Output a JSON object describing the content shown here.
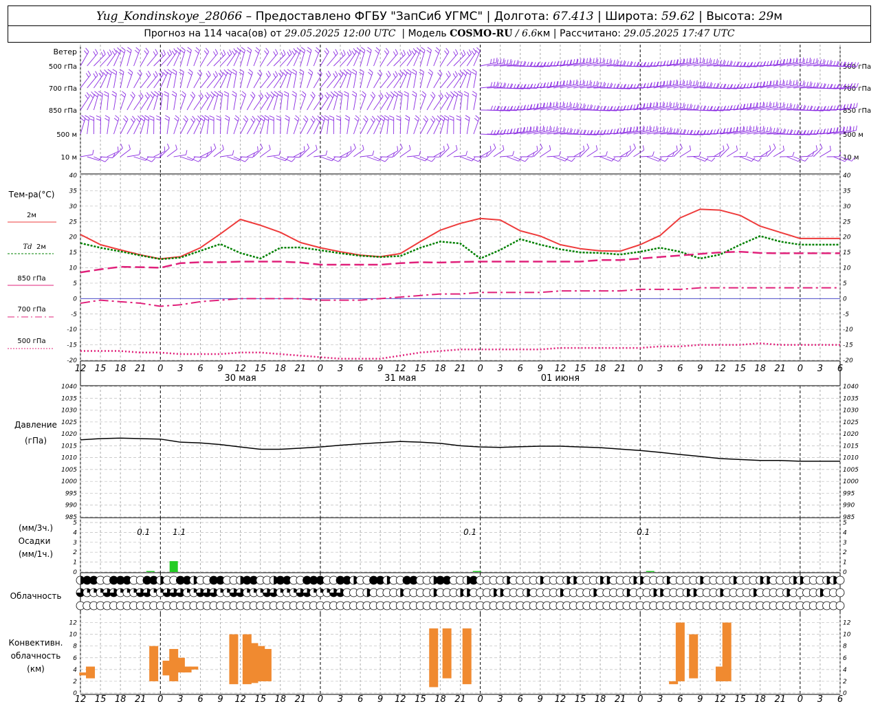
{
  "header": {
    "station": "Yug_Kondinskoye_28066",
    "dash": " – ",
    "provider": "Предоставлено ФГБУ \"ЗапСиб УГМС\"",
    "lon_label": "Долгота:",
    "lon": "67.413",
    "lat_label": "Широта:",
    "lat": "59.62",
    "alt_label": "Высота:",
    "alt": "29",
    "alt_unit": "м",
    "forecast_label": "Прогноз на 114 часа(ов) от",
    "forecast_time": "29.05.2025 12:00 UTC",
    "model_label": "Модель",
    "model": "COSMO-RU",
    "model_res": "/ 6.6",
    "model_res_unit": "км",
    "computed_label": "Рассчитано:",
    "computed_time": "29.05.2025 17:47 UTC"
  },
  "labels": {
    "wind": "Ветер",
    "wind_levels": [
      "500 гПа",
      "700 гПа",
      "850 гПа",
      "500 м",
      "10 м"
    ],
    "temp_title": "Тем-ра(°C)",
    "temp_2m": "2м",
    "td_name": "Td",
    "td_2m": "2м",
    "t850": "850 гПа",
    "t700": "700 гПа",
    "t500": "500 гПа",
    "pressure": "Давление",
    "pressure_unit": "(гПа)",
    "precip_unit3": "(мм/3ч.)",
    "precip": "Осадки",
    "precip_unit1": "(мм/1ч.)",
    "cloudiness": "Облачность",
    "convective": [
      "Конвективн.",
      "облачность",
      "(км)"
    ]
  },
  "colors": {
    "t2m": "#ee3b3b",
    "td": "#008000",
    "t850": "#e0207a",
    "t700": "#e0207a",
    "t500": "#e0207a",
    "wind": "#8a2be2",
    "pressure": "#000000",
    "precip": "#22cc22",
    "convective": "#f08a30"
  },
  "chart_data": [
    {
      "type": "line",
      "title": "Тем-ра(°C)",
      "x_hours": [
        0,
        3,
        6,
        9,
        12,
        15,
        18,
        21,
        24,
        27,
        30,
        33,
        36,
        39,
        42,
        45,
        48,
        51,
        54,
        57,
        60,
        63,
        66,
        69,
        72,
        75,
        78,
        81,
        84,
        87,
        90,
        93,
        96,
        99,
        102,
        105,
        108,
        111,
        114
      ],
      "x_tick_labels": [
        "12",
        "15",
        "18",
        "21",
        "0",
        "3",
        "6",
        "9",
        "12",
        "15",
        "18",
        "21",
        "0",
        "3",
        "6",
        "9",
        "12",
        "15",
        "18",
        "21",
        "0",
        "3",
        "6",
        "9",
        "12",
        "15",
        "18"
      ],
      "date_labels": [
        "30 мая",
        "31 мая",
        "01 июня"
      ],
      "ylim": [
        -20,
        40
      ],
      "series": [
        {
          "name": "2м",
          "values": [
            20.8,
            17.5,
            15.8,
            14.2,
            12.9,
            13.6,
            16.5,
            21.0,
            25.7,
            23.8,
            21.5,
            18.2,
            16.5,
            15.2,
            14.1,
            13.6,
            14.6,
            18.5,
            22.2,
            24.4,
            26.0,
            25.5,
            22.0,
            20.3,
            17.5,
            16.2,
            15.5,
            15.4,
            17.5,
            20.5,
            26.2,
            29.0,
            28.7,
            27.0,
            23.5,
            21.5,
            19.5,
            19.5,
            19.5
          ]
        },
        {
          "name": "Td 2м",
          "values": [
            18.0,
            16.5,
            15.3,
            14.0,
            12.8,
            13.3,
            15.5,
            17.7,
            14.8,
            13.0,
            16.5,
            16.6,
            15.7,
            14.7,
            13.9,
            13.5,
            13.8,
            16.5,
            18.5,
            17.9,
            13.0,
            15.8,
            19.3,
            17.5,
            16.0,
            15.0,
            14.8,
            14.3,
            15.2,
            16.5,
            15.2,
            13.0,
            14.3,
            17.5,
            20.3,
            18.5,
            17.5,
            17.5,
            17.5
          ]
        },
        {
          "name": "850 гПа",
          "values": [
            8.5,
            9.5,
            10.3,
            10.2,
            10.0,
            11.5,
            11.8,
            11.8,
            12.0,
            12.0,
            12.0,
            11.7,
            11.0,
            11.0,
            11.0,
            11.0,
            11.5,
            11.8,
            11.7,
            11.9,
            12.0,
            12.0,
            12.0,
            12.0,
            12.0,
            12.0,
            12.5,
            12.5,
            13.0,
            13.5,
            14.0,
            14.5,
            15.0,
            15.2,
            14.8,
            14.7,
            14.7,
            14.7,
            14.7
          ]
        },
        {
          "name": "700 гПа",
          "values": [
            -1.5,
            -0.5,
            -1.0,
            -1.5,
            -2.5,
            -2.0,
            -1.0,
            -0.5,
            0.0,
            0.0,
            0.0,
            0.0,
            -0.5,
            -0.5,
            -0.5,
            0.0,
            0.5,
            1.0,
            1.5,
            1.5,
            2.0,
            2.0,
            2.0,
            2.0,
            2.5,
            2.5,
            2.5,
            2.5,
            3.0,
            3.0,
            3.0,
            3.5,
            3.5,
            3.5,
            3.5,
            3.5,
            3.5,
            3.5,
            3.5
          ]
        },
        {
          "name": "500 гПа",
          "values": [
            -17.0,
            -17.0,
            -17.0,
            -17.5,
            -17.5,
            -18.0,
            -18.0,
            -18.0,
            -17.5,
            -17.5,
            -18.0,
            -18.5,
            -19.0,
            -19.5,
            -19.5,
            -19.5,
            -18.5,
            -17.5,
            -17.0,
            -16.5,
            -16.5,
            -16.5,
            -16.5,
            -16.5,
            -16.0,
            -16.0,
            -16.0,
            -16.0,
            -16.0,
            -15.5,
            -15.5,
            -15.0,
            -15.0,
            -15.0,
            -14.5,
            -15.0,
            -15.0,
            -15.0,
            -15.0
          ]
        }
      ]
    },
    {
      "type": "line",
      "title": "Давление",
      "ylabel": "(гПа)",
      "ylim": [
        985,
        1040
      ],
      "x_hours": [
        0,
        3,
        6,
        9,
        12,
        15,
        18,
        21,
        24,
        27,
        30,
        33,
        36,
        39,
        42,
        45,
        48,
        51,
        54,
        57,
        60,
        63,
        66,
        69,
        72,
        75,
        78,
        81,
        84,
        87,
        90,
        93,
        96,
        99,
        102,
        105,
        108,
        111,
        114
      ],
      "series": [
        {
          "name": "Давление",
          "values": [
            1017.5,
            1018.0,
            1018.2,
            1018.0,
            1017.8,
            1016.5,
            1016.2,
            1015.5,
            1014.5,
            1013.5,
            1013.5,
            1014.0,
            1014.5,
            1015.2,
            1015.8,
            1016.3,
            1016.8,
            1016.5,
            1016.0,
            1015.0,
            1014.5,
            1014.3,
            1014.6,
            1014.8,
            1014.8,
            1014.5,
            1014.2,
            1013.6,
            1013.0,
            1012.2,
            1011.3,
            1010.5,
            1009.6,
            1009.2,
            1008.8,
            1008.8,
            1008.5,
            1008.5,
            1008.5
          ]
        }
      ]
    },
    {
      "type": "bar",
      "title": "Осадки",
      "ylim": [
        0,
        5
      ],
      "ylabel": "(мм/3ч.) / (мм/1ч.)",
      "bars": [
        {
          "hour": 10.5,
          "value": 0.1,
          "label": "0.1"
        },
        {
          "hour": 14,
          "value": 1.1,
          "label": "1.1"
        },
        {
          "hour": 59.5,
          "value": 0.1,
          "label": "0.1"
        },
        {
          "hour": 85.5,
          "value": 0.1,
          "label": "0.1"
        }
      ]
    },
    {
      "type": "bar",
      "title": "Конвективн. облачность (км)",
      "ylim": [
        0,
        13
      ],
      "bars": [
        {
          "hour": 0.5,
          "base": 3.0,
          "top": 3.5
        },
        {
          "hour": 1.5,
          "base": 2.5,
          "top": 4.5
        },
        {
          "hour": 11,
          "base": 2.0,
          "top": 8.0
        },
        {
          "hour": 13,
          "base": 3.0,
          "top": 5.5
        },
        {
          "hour": 14,
          "base": 2.0,
          "top": 7.5
        },
        {
          "hour": 15,
          "base": 3.5,
          "top": 6.0
        },
        {
          "hour": 16,
          "base": 3.5,
          "top": 4.5
        },
        {
          "hour": 17,
          "base": 4.0,
          "top": 4.5
        },
        {
          "hour": 23,
          "base": 1.5,
          "top": 10.0
        },
        {
          "hour": 25,
          "base": 1.5,
          "top": 10.0
        },
        {
          "hour": 26,
          "base": 1.7,
          "top": 8.5
        },
        {
          "hour": 27,
          "base": 2.0,
          "top": 8.0
        },
        {
          "hour": 28,
          "base": 2.0,
          "top": 7.5
        },
        {
          "hour": 53,
          "base": 1.0,
          "top": 11.0
        },
        {
          "hour": 55,
          "base": 2.5,
          "top": 11.0
        },
        {
          "hour": 58,
          "base": 1.5,
          "top": 11.0
        },
        {
          "hour": 89,
          "base": 1.5,
          "top": 2.0
        },
        {
          "hour": 90,
          "base": 2.0,
          "top": 12.0
        },
        {
          "hour": 92,
          "base": 2.5,
          "top": 10.0
        },
        {
          "hour": 96,
          "base": 2.0,
          "top": 4.5
        },
        {
          "hour": 97,
          "base": 2.0,
          "top": 12.0
        }
      ]
    }
  ]
}
